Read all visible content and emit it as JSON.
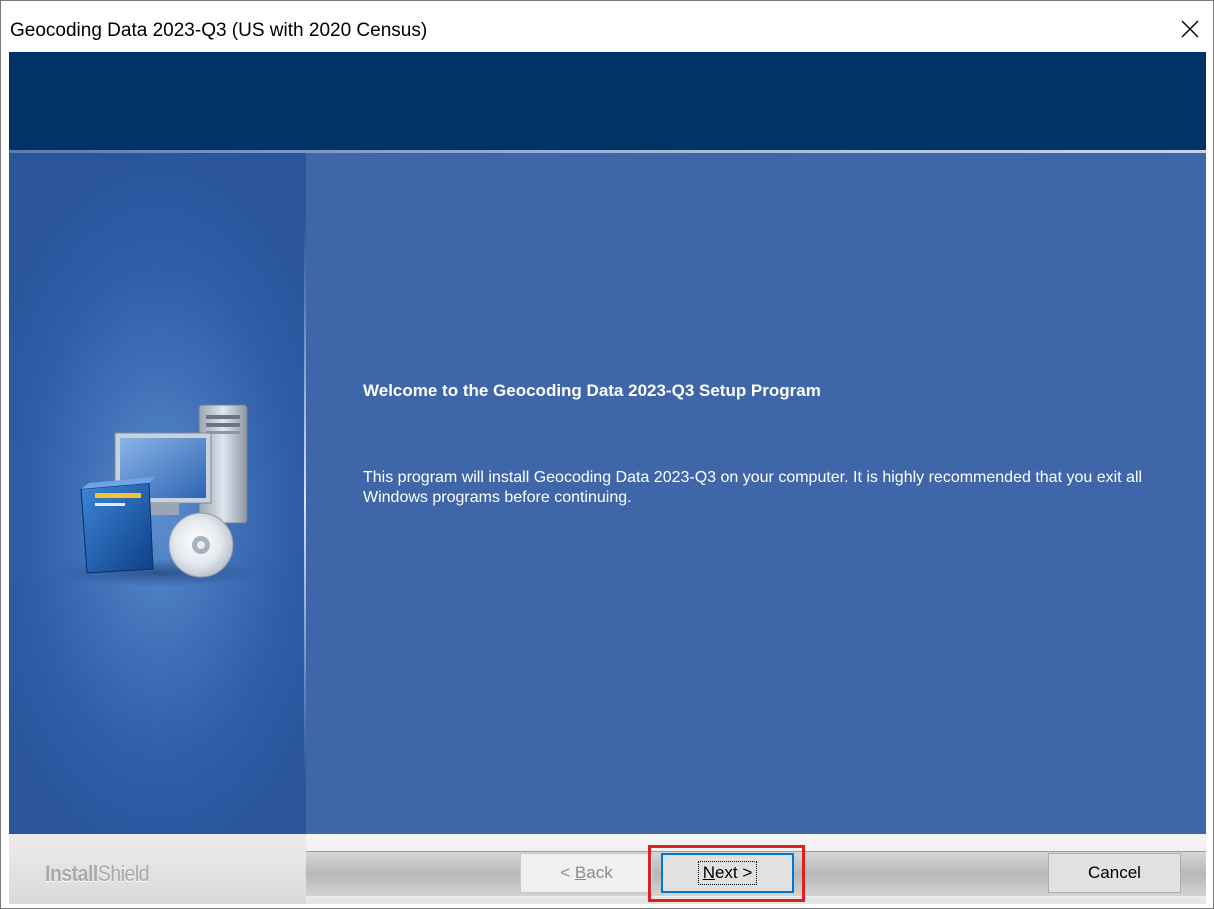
{
  "window": {
    "title": "Geocoding Data 2023-Q3 (US with 2020 Census)",
    "close_icon": "close-icon"
  },
  "colors": {
    "header_band": "#003366",
    "main_panel": "#4066aa",
    "highlight": "#e02020"
  },
  "welcome": {
    "title": "Welcome to the Geocoding Data 2023-Q3 Setup Program",
    "body": "This program will install Geocoding Data 2023-Q3 on your computer. It is highly recommended that you exit all Windows programs before continuing."
  },
  "illustration": {
    "icon": "computer-install-icon"
  },
  "footer": {
    "brand_bold": "Install",
    "brand_thin": "Shield",
    "back_label_pre": "< ",
    "back_label_key": "B",
    "back_label_post": "ack",
    "next_label_key": "N",
    "next_label_post": "ext >",
    "cancel_label": "Cancel"
  }
}
